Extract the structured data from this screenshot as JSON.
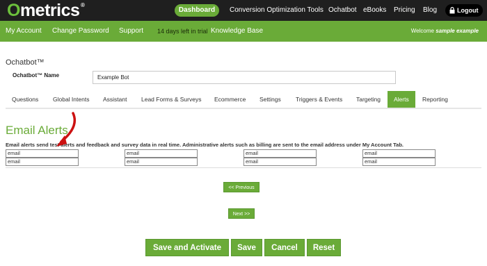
{
  "brand": {
    "logo_text": "metrics",
    "logo_o": "O",
    "trademark": "®"
  },
  "topnav": {
    "dashboard": "Dashboard",
    "items": [
      "Conversion Optimization Tools",
      "Ochatbot",
      "eBooks",
      "Pricing",
      "Blog"
    ],
    "logout": "Logout"
  },
  "subnav": {
    "items": [
      "My Account",
      "Change Password",
      "Support"
    ],
    "trial": "14 days left in trial",
    "kb": "Knowledge Base",
    "welcome_prefix": "Welcome",
    "welcome_user": "sample example"
  },
  "page": {
    "title": "Ochatbot™",
    "name_label": "Ochatbot™ Name",
    "name_value": "Example Bot"
  },
  "tabs": [
    "Questions",
    "Global Intents",
    "Assistant",
    "Lead Forms & Surveys",
    "Ecommerce",
    "Settings",
    "Triggers & Events",
    "Targeting",
    "Alerts",
    "Reporting"
  ],
  "active_tab": "Alerts",
  "alerts": {
    "heading": "Email Alerts",
    "description": "Email alerts send test alerts and feedback and survey data in real time. Administrative alerts such as billing are sent to the email address under My Account Tab.",
    "fields": [
      "email",
      "email",
      "email",
      "email",
      "email",
      "email",
      "email",
      "email"
    ]
  },
  "pager": {
    "previous": "<< Previous",
    "next": "Next >>"
  },
  "actions": {
    "save_activate": "Save and Activate",
    "save": "Save",
    "cancel": "Cancel",
    "reset": "Reset"
  },
  "colors": {
    "accent": "#6aab38",
    "topbar": "#1f1f1f",
    "arrow": "#cc1111"
  }
}
